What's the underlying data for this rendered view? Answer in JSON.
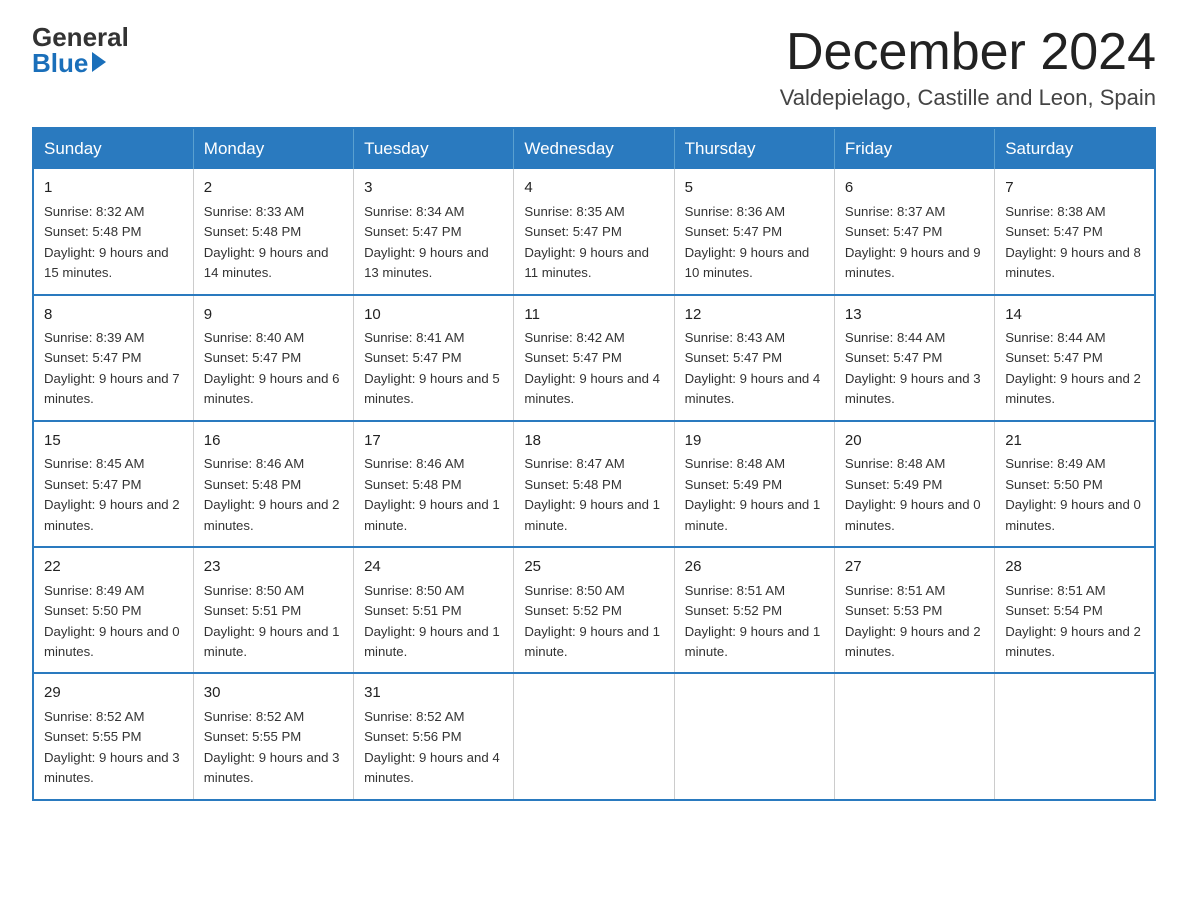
{
  "logo": {
    "general": "General",
    "blue": "Blue"
  },
  "title": "December 2024",
  "location": "Valdepielago, Castille and Leon, Spain",
  "headers": [
    "Sunday",
    "Monday",
    "Tuesday",
    "Wednesday",
    "Thursday",
    "Friday",
    "Saturday"
  ],
  "weeks": [
    [
      {
        "day": "1",
        "sunrise": "8:32 AM",
        "sunset": "5:48 PM",
        "daylight": "9 hours and 15 minutes."
      },
      {
        "day": "2",
        "sunrise": "8:33 AM",
        "sunset": "5:48 PM",
        "daylight": "9 hours and 14 minutes."
      },
      {
        "day": "3",
        "sunrise": "8:34 AM",
        "sunset": "5:47 PM",
        "daylight": "9 hours and 13 minutes."
      },
      {
        "day": "4",
        "sunrise": "8:35 AM",
        "sunset": "5:47 PM",
        "daylight": "9 hours and 11 minutes."
      },
      {
        "day": "5",
        "sunrise": "8:36 AM",
        "sunset": "5:47 PM",
        "daylight": "9 hours and 10 minutes."
      },
      {
        "day": "6",
        "sunrise": "8:37 AM",
        "sunset": "5:47 PM",
        "daylight": "9 hours and 9 minutes."
      },
      {
        "day": "7",
        "sunrise": "8:38 AM",
        "sunset": "5:47 PM",
        "daylight": "9 hours and 8 minutes."
      }
    ],
    [
      {
        "day": "8",
        "sunrise": "8:39 AM",
        "sunset": "5:47 PM",
        "daylight": "9 hours and 7 minutes."
      },
      {
        "day": "9",
        "sunrise": "8:40 AM",
        "sunset": "5:47 PM",
        "daylight": "9 hours and 6 minutes."
      },
      {
        "day": "10",
        "sunrise": "8:41 AM",
        "sunset": "5:47 PM",
        "daylight": "9 hours and 5 minutes."
      },
      {
        "day": "11",
        "sunrise": "8:42 AM",
        "sunset": "5:47 PM",
        "daylight": "9 hours and 4 minutes."
      },
      {
        "day": "12",
        "sunrise": "8:43 AM",
        "sunset": "5:47 PM",
        "daylight": "9 hours and 4 minutes."
      },
      {
        "day": "13",
        "sunrise": "8:44 AM",
        "sunset": "5:47 PM",
        "daylight": "9 hours and 3 minutes."
      },
      {
        "day": "14",
        "sunrise": "8:44 AM",
        "sunset": "5:47 PM",
        "daylight": "9 hours and 2 minutes."
      }
    ],
    [
      {
        "day": "15",
        "sunrise": "8:45 AM",
        "sunset": "5:47 PM",
        "daylight": "9 hours and 2 minutes."
      },
      {
        "day": "16",
        "sunrise": "8:46 AM",
        "sunset": "5:48 PM",
        "daylight": "9 hours and 2 minutes."
      },
      {
        "day": "17",
        "sunrise": "8:46 AM",
        "sunset": "5:48 PM",
        "daylight": "9 hours and 1 minute."
      },
      {
        "day": "18",
        "sunrise": "8:47 AM",
        "sunset": "5:48 PM",
        "daylight": "9 hours and 1 minute."
      },
      {
        "day": "19",
        "sunrise": "8:48 AM",
        "sunset": "5:49 PM",
        "daylight": "9 hours and 1 minute."
      },
      {
        "day": "20",
        "sunrise": "8:48 AM",
        "sunset": "5:49 PM",
        "daylight": "9 hours and 0 minutes."
      },
      {
        "day": "21",
        "sunrise": "8:49 AM",
        "sunset": "5:50 PM",
        "daylight": "9 hours and 0 minutes."
      }
    ],
    [
      {
        "day": "22",
        "sunrise": "8:49 AM",
        "sunset": "5:50 PM",
        "daylight": "9 hours and 0 minutes."
      },
      {
        "day": "23",
        "sunrise": "8:50 AM",
        "sunset": "5:51 PM",
        "daylight": "9 hours and 1 minute."
      },
      {
        "day": "24",
        "sunrise": "8:50 AM",
        "sunset": "5:51 PM",
        "daylight": "9 hours and 1 minute."
      },
      {
        "day": "25",
        "sunrise": "8:50 AM",
        "sunset": "5:52 PM",
        "daylight": "9 hours and 1 minute."
      },
      {
        "day": "26",
        "sunrise": "8:51 AM",
        "sunset": "5:52 PM",
        "daylight": "9 hours and 1 minute."
      },
      {
        "day": "27",
        "sunrise": "8:51 AM",
        "sunset": "5:53 PM",
        "daylight": "9 hours and 2 minutes."
      },
      {
        "day": "28",
        "sunrise": "8:51 AM",
        "sunset": "5:54 PM",
        "daylight": "9 hours and 2 minutes."
      }
    ],
    [
      {
        "day": "29",
        "sunrise": "8:52 AM",
        "sunset": "5:55 PM",
        "daylight": "9 hours and 3 minutes."
      },
      {
        "day": "30",
        "sunrise": "8:52 AM",
        "sunset": "5:55 PM",
        "daylight": "9 hours and 3 minutes."
      },
      {
        "day": "31",
        "sunrise": "8:52 AM",
        "sunset": "5:56 PM",
        "daylight": "9 hours and 4 minutes."
      },
      null,
      null,
      null,
      null
    ]
  ]
}
